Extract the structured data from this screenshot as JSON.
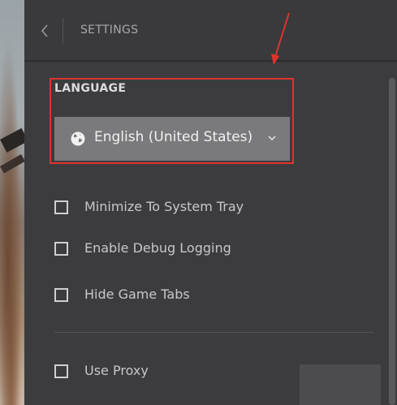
{
  "header": {
    "back_icon": "chevron-left-icon",
    "title": "SETTINGS"
  },
  "language": {
    "label": "LANGUAGE",
    "selected": "English (United States)",
    "icon": "globe-icon"
  },
  "options": [
    {
      "label": "Minimize To System Tray",
      "checked": false
    },
    {
      "label": "Enable Debug Logging",
      "checked": false
    },
    {
      "label": "Hide Game Tabs",
      "checked": false
    },
    {
      "label": "Use Proxy",
      "checked": false
    }
  ],
  "annotation_color": "#e0322d"
}
